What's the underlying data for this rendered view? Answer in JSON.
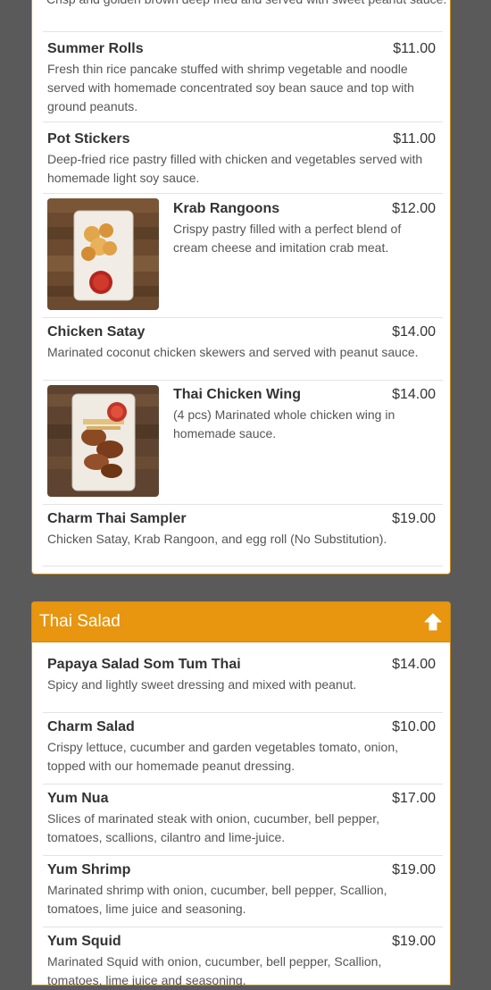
{
  "appetizers": {
    "items": [
      {
        "name": "",
        "price": "",
        "description": "Crisp and golden brown deep fried and served with sweet peanut sauce."
      },
      {
        "name": "Summer Rolls",
        "price": "$11.00",
        "description": "Fresh thin rice pancake stuffed with shrimp vegetable and noodle served with homemade concentrated soy bean sauce and top with ground peanuts."
      },
      {
        "name": "Pot Stickers",
        "price": "$11.00",
        "description": "Deep-fried rice pastry filled with chicken and vegetables served with homemade light soy sauce."
      },
      {
        "name": "Krab Rangoons",
        "price": "$12.00",
        "description": "Crispy pastry filled with a perfect blend of cream cheese and imitation crab meat.",
        "image_icon": "krab-rangoons-photo"
      },
      {
        "name": "Chicken Satay",
        "price": "$14.00",
        "description": "Marinated coconut chicken skewers and served with peanut sauce."
      },
      {
        "name": "Thai Chicken Wing",
        "price": "$14.00",
        "description": "(4 pcs) Marinated whole chicken wing in homemade sauce.",
        "image_icon": "thai-chicken-wing-photo"
      },
      {
        "name": "Charm Thai Sampler",
        "price": "$19.00",
        "description": "Chicken Satay, Krab Rangoon, and egg roll (No Substitution)."
      }
    ]
  },
  "salad": {
    "title": "Thai Salad",
    "up_icon": "arrow-circle-up-icon",
    "items": [
      {
        "name": "Papaya Salad Som Tum Thai",
        "price": "$14.00",
        "description": "Spicy and lightly sweet dressing and mixed with peanut."
      },
      {
        "name": "Charm Salad",
        "price": "$10.00",
        "description": "Crispy lettuce, cucumber and garden vegetables tomato, onion, topped with our homemade peanut dressing."
      },
      {
        "name": "Yum Nua",
        "price": "$17.00",
        "description": "Slices of marinated steak with onion, cucumber, bell pepper, tomatoes, scallions, cilantro and lime-juice."
      },
      {
        "name": "Yum Shrimp",
        "price": "$19.00",
        "description": "Marinated shrimp with onion, cucumber, bell pepper, Scallion, tomatoes, lime juice and seasoning."
      },
      {
        "name": "Yum Squid",
        "price": "$19.00",
        "description": "Marinated Squid with onion, cucumber, bell pepper, Scallion, tomatoes, lime juice and seasoning."
      }
    ]
  },
  "colors": {
    "heading_bg": "#e8950f",
    "backdrop": "#5a5a5a"
  }
}
